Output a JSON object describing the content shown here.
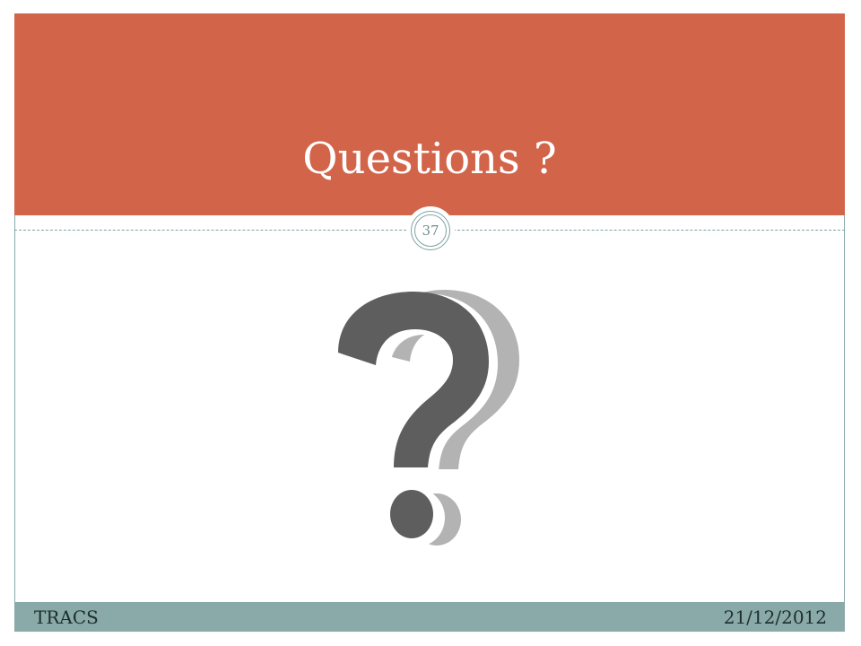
{
  "slide": {
    "title": "Questions ?",
    "page_number": "37",
    "image": "question-mark-icon"
  },
  "footer": {
    "left_text": "TRACS",
    "right_text": "21/12/2012"
  },
  "colors": {
    "title_band": "#d2644a",
    "accent_teal": "#8aa9a9",
    "qmark_dark": "#5e5e5e",
    "qmark_shadow": "#b3b3b3"
  }
}
